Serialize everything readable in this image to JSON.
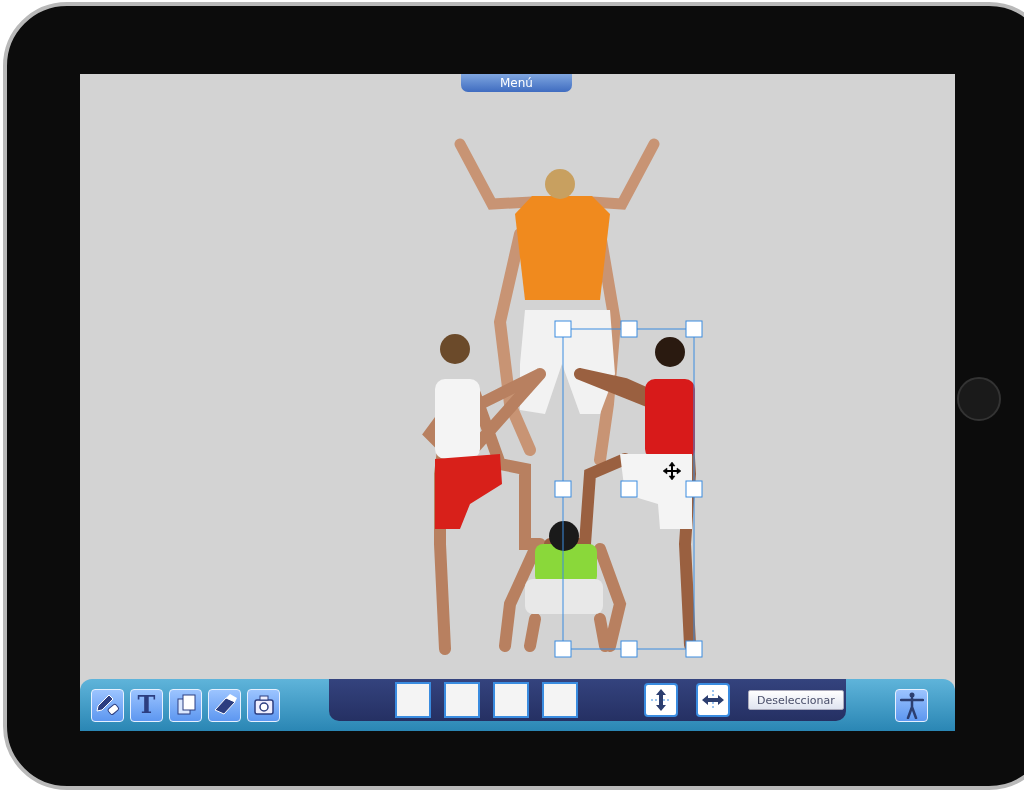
{
  "menu": {
    "label": "Menú"
  },
  "tools": [
    {
      "kind": "pencil"
    },
    {
      "kind": "text",
      "glyph": "T"
    },
    {
      "kind": "layers"
    },
    {
      "kind": "eraser"
    },
    {
      "kind": "camera"
    }
  ],
  "flip_buttons": [
    {
      "kind": "vertical"
    },
    {
      "kind": "horizontal"
    }
  ],
  "deselect_button": {
    "label": "Deseleccionar"
  }
}
